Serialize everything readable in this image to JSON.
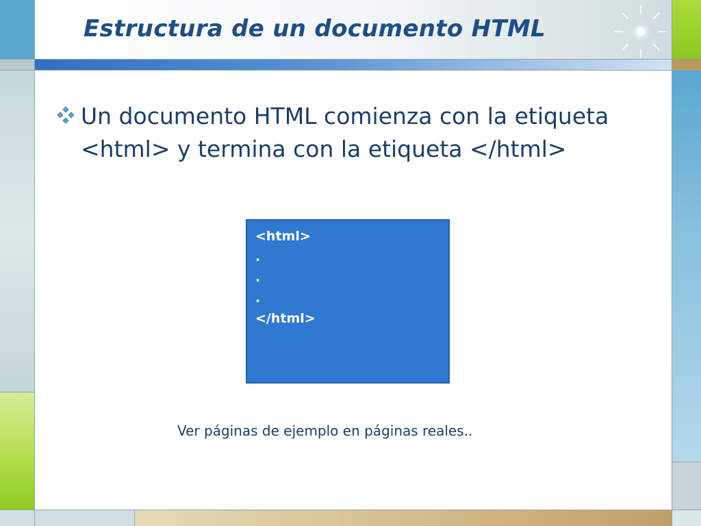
{
  "slide": {
    "title": "Estructura de un documento HTML",
    "bullet": "Un documento HTML comienza con la etiqueta <html> y termina con la etiqueta </html>",
    "code_lines": [
      "<html>",
      ".",
      ".",
      ".",
      "</html>"
    ],
    "note": "Ver páginas de ejemplo en páginas reales.."
  },
  "icons": {
    "bullet": "diamond-bullet-icon",
    "decoration": "sparkle-icon"
  },
  "colors": {
    "title": "#1f4e86",
    "text": "#1c3d68",
    "code_box": "#2f79d1",
    "accent_blue": "#5aa7d0",
    "accent_green": "#8cc81f",
    "accent_tan": "#b99a59"
  }
}
